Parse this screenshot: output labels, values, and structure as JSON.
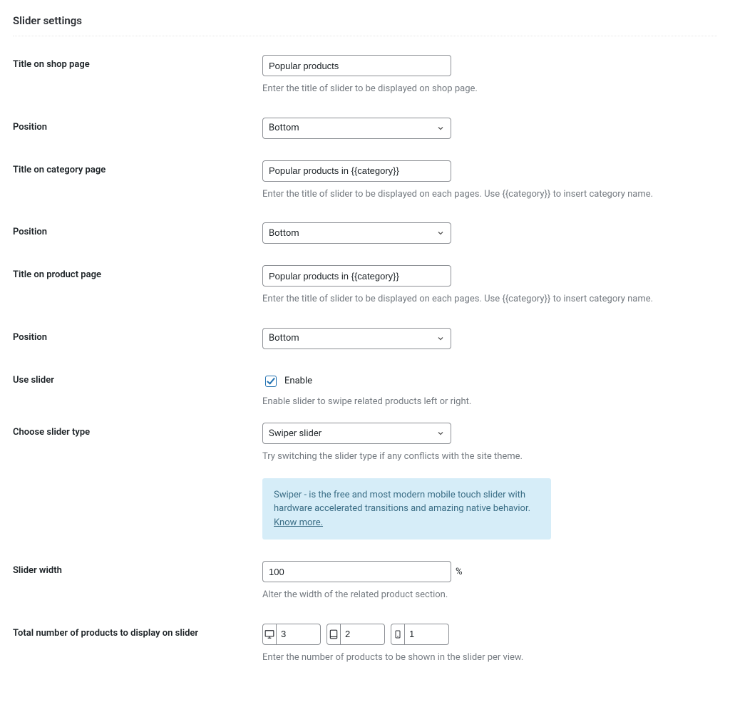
{
  "section_title": "Slider settings",
  "fields": {
    "title_shop": {
      "label": "Title on shop page",
      "value": "Popular products",
      "desc": "Enter the title of slider to be displayed on shop page."
    },
    "position_shop": {
      "label": "Position",
      "value": "Bottom"
    },
    "title_category": {
      "label": "Title on category page",
      "value": "Popular products in {{category}}",
      "desc": "Enter the title of slider to be displayed on each pages. Use {{category}} to insert category name."
    },
    "position_category": {
      "label": "Position",
      "value": "Bottom"
    },
    "title_product": {
      "label": "Title on product page",
      "value": "Popular products in {{category}}",
      "desc": "Enter the title of slider to be displayed on each pages. Use {{category}} to insert category name."
    },
    "position_product": {
      "label": "Position",
      "value": "Bottom"
    },
    "use_slider": {
      "label": "Use slider",
      "checkbox_label": "Enable",
      "desc": "Enable slider to swipe related products left or right."
    },
    "slider_type": {
      "label": "Choose slider type",
      "value": "Swiper slider",
      "desc": "Try switching the slider type if any conflicts with the site theme."
    },
    "info": {
      "text": "Swiper - is the free and most modern mobile touch slider with hardware accelerated transitions and amazing native behavior. ",
      "link_text": "Know more."
    },
    "slider_width": {
      "label": "Slider width",
      "value": "100",
      "unit": "%",
      "desc": "Alter the width of the related product section."
    },
    "total_products": {
      "label": "Total number of products to display on slider",
      "desktop": "3",
      "tablet": "2",
      "mobile": "1",
      "desc": "Enter the number of products to be shown in the slider per view."
    }
  }
}
